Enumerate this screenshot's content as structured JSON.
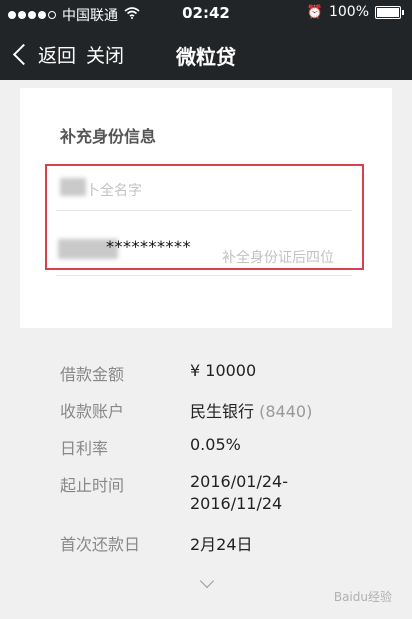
{
  "status_bar": {
    "carrier": "中国联通",
    "time": "02:42",
    "battery": "100%",
    "icons": [
      "signal-dots",
      "wifi-icon",
      "alarm-icon",
      "battery-icon"
    ]
  },
  "nav": {
    "back_label": "返回",
    "close_label": "关闭",
    "title": "微粒贷"
  },
  "form": {
    "section_title": "补充身份信息",
    "name_placeholder": "补全名字",
    "name_placeholder_visible": "卜全名字",
    "id_masked": "**********",
    "id_placeholder": "补全身份证后四位"
  },
  "info": {
    "rows": [
      {
        "label": "借款金额",
        "value": "¥ 10000"
      },
      {
        "label": "收款账户",
        "value": "民生银行",
        "extra": "(8440)"
      },
      {
        "label": "日利率",
        "value": "0.05%"
      },
      {
        "label": "起止时间",
        "value": "2016/01/24-",
        "value2": "2016/11/24"
      },
      {
        "label": "首次还款日",
        "value": "2月24日"
      }
    ]
  },
  "colors": {
    "nav_bg": "#222527",
    "highlight_border": "#d8404c",
    "page_bg": "#f0f0f0"
  },
  "watermark": "Baidu经验"
}
